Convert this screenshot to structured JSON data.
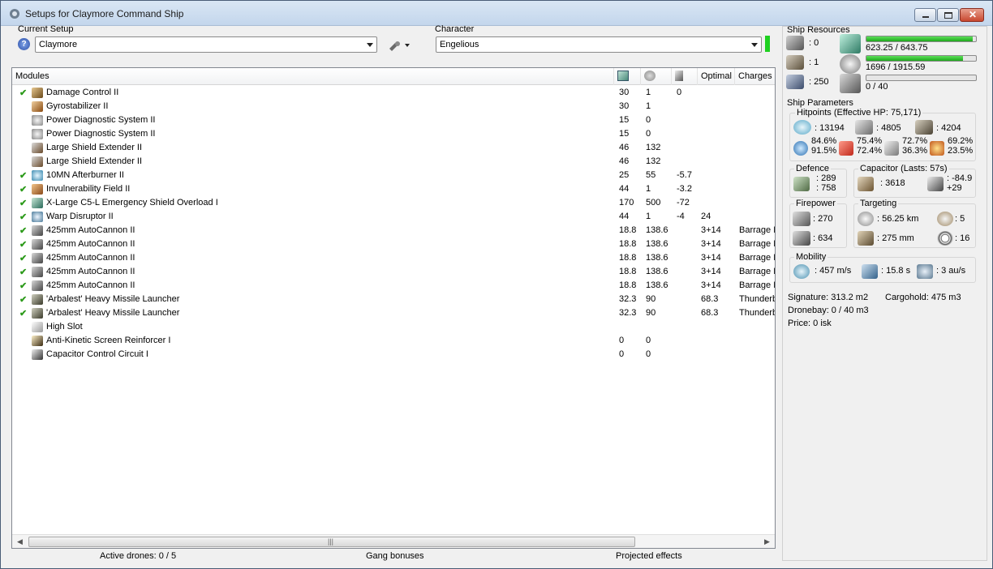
{
  "window": {
    "title": "Setups for Claymore Command Ship"
  },
  "current_setup": {
    "label": "Current Setup",
    "value": "Claymore"
  },
  "character": {
    "label": "Character",
    "value": "Engelious"
  },
  "modules": {
    "columns": {
      "name": "Modules",
      "optimal": "Optimal",
      "charges": "Charges"
    },
    "rows": [
      {
        "check": true,
        "icon": "damage-control-icon",
        "name": "Damage Control II",
        "cpu": "30",
        "pg": "1",
        "cap": "0",
        "optimal": "",
        "charges": ""
      },
      {
        "check": false,
        "icon": "gyrostabilizer-icon",
        "name": "Gyrostabilizer II",
        "cpu": "30",
        "pg": "1",
        "cap": "",
        "optimal": "",
        "charges": ""
      },
      {
        "check": false,
        "icon": "power-diagnostic-icon",
        "name": "Power Diagnostic System II",
        "cpu": "15",
        "pg": "0",
        "cap": "",
        "optimal": "",
        "charges": ""
      },
      {
        "check": false,
        "icon": "power-diagnostic-icon",
        "name": "Power Diagnostic System II",
        "cpu": "15",
        "pg": "0",
        "cap": "",
        "optimal": "",
        "charges": ""
      },
      {
        "check": false,
        "icon": "shield-extender-icon",
        "name": "Large Shield Extender II",
        "cpu": "46",
        "pg": "132",
        "cap": "",
        "optimal": "",
        "charges": ""
      },
      {
        "check": false,
        "icon": "shield-extender-icon",
        "name": "Large Shield Extender II",
        "cpu": "46",
        "pg": "132",
        "cap": "",
        "optimal": "",
        "charges": ""
      },
      {
        "check": true,
        "icon": "afterburner-icon",
        "name": "10MN Afterburner II",
        "cpu": "25",
        "pg": "55",
        "cap": "-5.7",
        "optimal": "",
        "charges": ""
      },
      {
        "check": true,
        "icon": "invulnerability-field-icon",
        "name": "Invulnerability Field II",
        "cpu": "44",
        "pg": "1",
        "cap": "-3.2",
        "optimal": "",
        "charges": ""
      },
      {
        "check": true,
        "icon": "shield-overload-icon",
        "name": "X-Large C5-L Emergency Shield Overload I",
        "cpu": "170",
        "pg": "500",
        "cap": "-72",
        "optimal": "",
        "charges": ""
      },
      {
        "check": true,
        "icon": "warp-disruptor-icon",
        "name": "Warp Disruptor II",
        "cpu": "44",
        "pg": "1",
        "cap": "-4",
        "optimal": "24",
        "charges": ""
      },
      {
        "check": true,
        "icon": "autocannon-icon",
        "name": "425mm AutoCannon II",
        "cpu": "18.8",
        "pg": "138.6",
        "cap": "",
        "optimal": "3+14",
        "charges": "Barrage L"
      },
      {
        "check": true,
        "icon": "autocannon-icon",
        "name": "425mm AutoCannon II",
        "cpu": "18.8",
        "pg": "138.6",
        "cap": "",
        "optimal": "3+14",
        "charges": "Barrage L"
      },
      {
        "check": true,
        "icon": "autocannon-icon",
        "name": "425mm AutoCannon II",
        "cpu": "18.8",
        "pg": "138.6",
        "cap": "",
        "optimal": "3+14",
        "charges": "Barrage L"
      },
      {
        "check": true,
        "icon": "autocannon-icon",
        "name": "425mm AutoCannon II",
        "cpu": "18.8",
        "pg": "138.6",
        "cap": "",
        "optimal": "3+14",
        "charges": "Barrage L"
      },
      {
        "check": true,
        "icon": "autocannon-icon",
        "name": "425mm AutoCannon II",
        "cpu": "18.8",
        "pg": "138.6",
        "cap": "",
        "optimal": "3+14",
        "charges": "Barrage L"
      },
      {
        "check": true,
        "icon": "missile-launcher-icon",
        "name": "'Arbalest' Heavy Missile Launcher",
        "cpu": "32.3",
        "pg": "90",
        "cap": "",
        "optimal": "68.3",
        "charges": "Thunderbolt"
      },
      {
        "check": true,
        "icon": "missile-launcher-icon",
        "name": "'Arbalest' Heavy Missile Launcher",
        "cpu": "32.3",
        "pg": "90",
        "cap": "",
        "optimal": "68.3",
        "charges": "Thunderbolt"
      },
      {
        "check": false,
        "icon": "high-slot-icon",
        "name": "High Slot",
        "cpu": "",
        "pg": "",
        "cap": "",
        "optimal": "",
        "charges": ""
      },
      {
        "check": false,
        "icon": "screen-reinforcer-icon",
        "name": "Anti-Kinetic Screen Reinforcer I",
        "cpu": "0",
        "pg": "0",
        "cap": "",
        "optimal": "",
        "charges": ""
      },
      {
        "check": false,
        "icon": "capacitor-control-icon",
        "name": "Capacitor Control Circuit I",
        "cpu": "0",
        "pg": "0",
        "cap": "",
        "optimal": "",
        "charges": ""
      }
    ]
  },
  "status": {
    "active_drones": "Active drones: 0 / 5",
    "gang_bonuses": "Gang bonuses",
    "projected_effects": "Projected effects"
  },
  "resources": {
    "title": "Ship Resources",
    "turret_hardpoints": ": 0",
    "launcher_hardpoints": ": 1",
    "calibration": ": 250",
    "cpu": {
      "text": "623.25 / 643.75",
      "fraction": 0.968
    },
    "powergrid": {
      "text": "1696 / 1915.59",
      "fraction": 0.885
    },
    "drone_bandwidth": {
      "text": "0 / 40",
      "fraction": 0.0
    }
  },
  "parameters": {
    "title": "Ship Parameters",
    "hitpoints": {
      "title": "Hitpoints (Effective HP: 75,171)",
      "shield": ": 13194",
      "armor": ": 4805",
      "structure": ": 4204",
      "em_res_1": "84.6%",
      "em_res_2": "91.5%",
      "th_res_1": "75.4%",
      "th_res_2": "72.4%",
      "kin_res_1": "72.7%",
      "kin_res_2": "36.3%",
      "exp_res_1": "69.2%",
      "exp_res_2": "23.5%"
    },
    "defence": {
      "title": "Defence",
      "val1": ": 289",
      "val2": ": 758"
    },
    "capacitor": {
      "title": "Capacitor (Lasts: 57s)",
      "capacity": ": 3618",
      "delta1": ": -84.9",
      "delta2": "+29"
    },
    "firepower": {
      "title": "Firepower",
      "turret": ": 270",
      "missile": ": 634"
    },
    "targeting": {
      "title": "Targeting",
      "range": ": 56.25 km",
      "targets": ": 5",
      "scan": ": 275 mm",
      "sensor": ": 16"
    },
    "mobility": {
      "title": "Mobility",
      "speed": ": 457 m/s",
      "align": ": 15.8 s",
      "warp": ": 3 au/s"
    },
    "signature": "Signature: 313.2 m2",
    "cargohold": "Cargohold: 475 m3",
    "dronebay": "Dronebay: 0 / 40 m3",
    "price": "Price: 0 isk"
  }
}
